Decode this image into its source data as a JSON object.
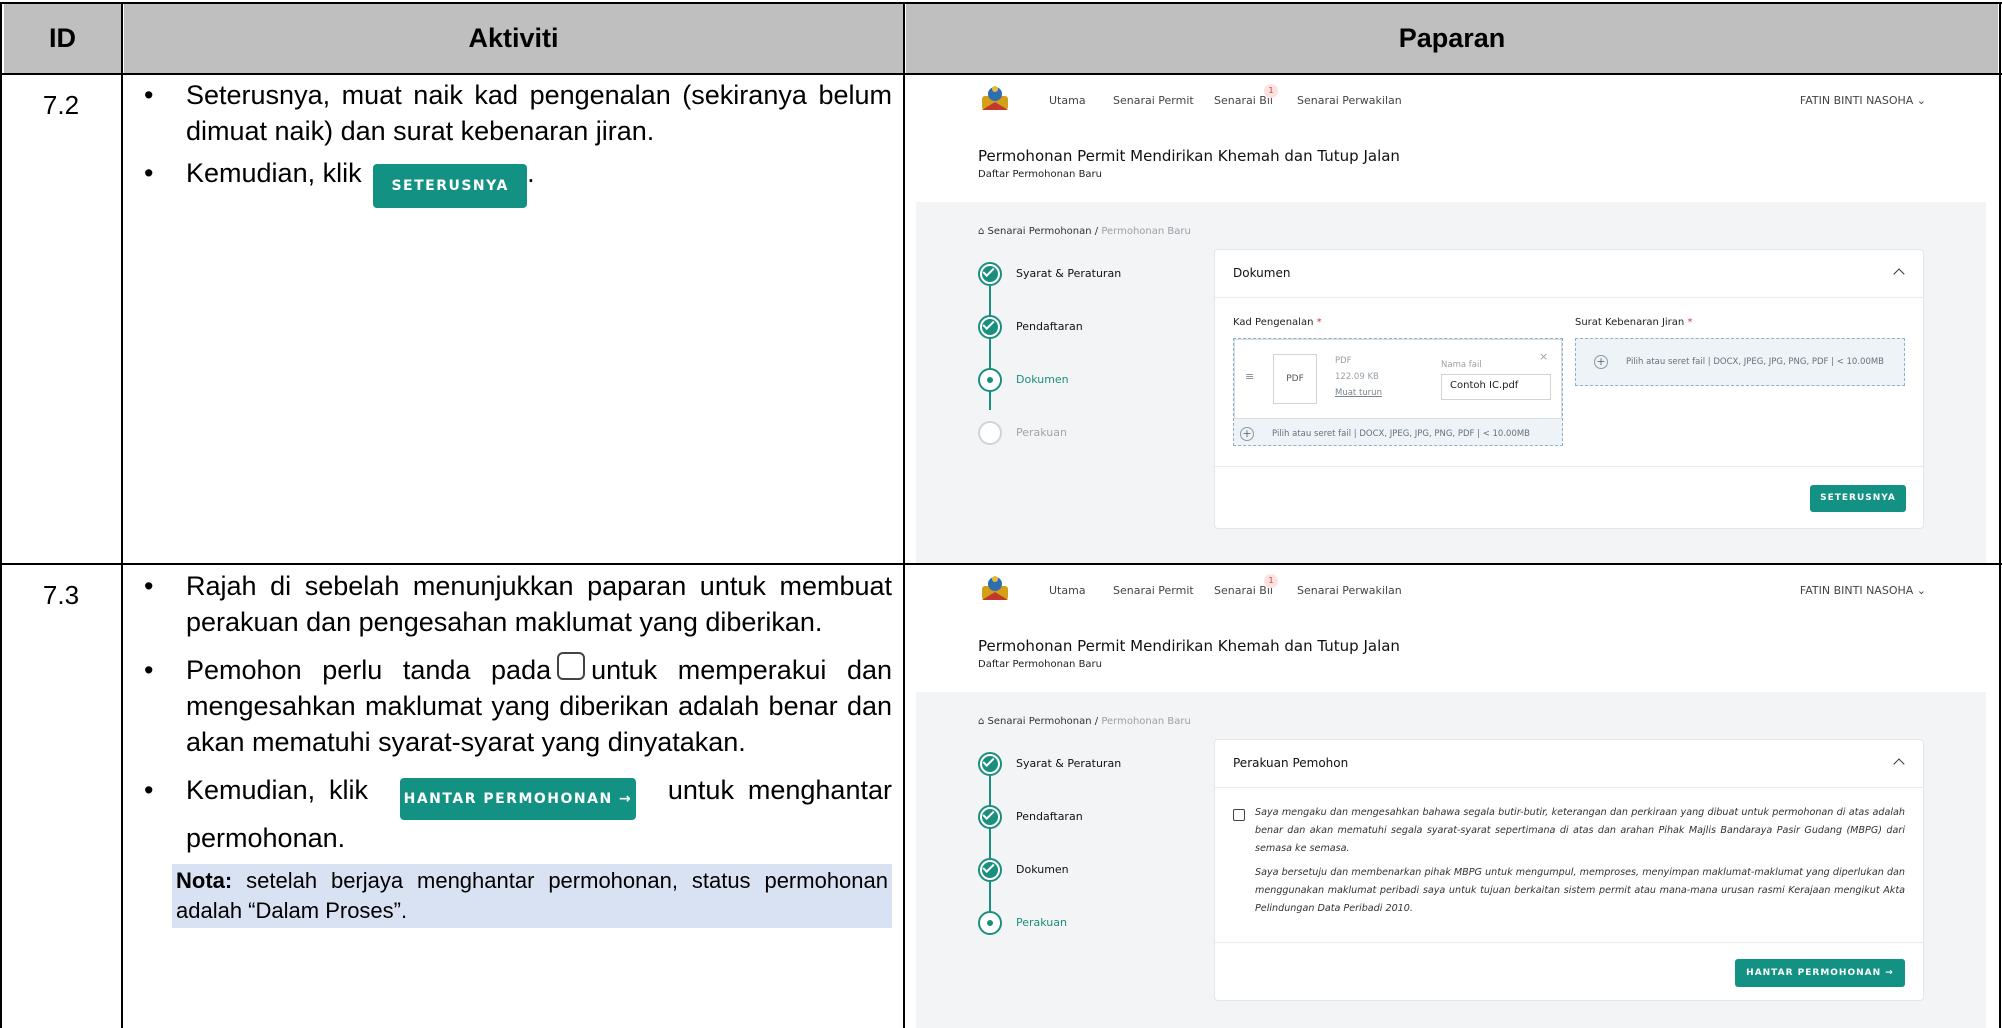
{
  "table": {
    "headers": {
      "id": "ID",
      "activity": "Aktiviti",
      "display": "Paparan"
    },
    "rows": [
      {
        "id": "7.2",
        "bullets": [
          "Seterusnya, muat naik kad pengenalan (sekiranya belum dimuat naik) dan surat kebenaran jiran.",
          "Kemudian, klik"
        ],
        "inline_button": "SETERUSNYA",
        "trailing": "."
      },
      {
        "id": "7.3",
        "bullet1": "Rajah di sebelah menunjukkan paparan untuk membuat perakuan dan pengesahan maklumat yang diberikan.",
        "bullet2_pre": "Pemohon perlu tanda pada",
        "bullet2_post": "untuk memperakui dan mengesahkan maklumat yang diberikan adalah benar dan akan mematuhi syarat-syarat yang dinyatakan.",
        "bullet3_pre": "Kemudian, klik",
        "bullet3_button": "HANTAR PERMOHONAN →",
        "bullet3_post": "untuk menghantar permohonan.",
        "note_label": "Nota:",
        "note_text": "setelah berjaya menghantar permohonan, status permohonan adalah “Dalam Proses”."
      }
    ]
  },
  "app": {
    "nav": [
      "Utama",
      "Senarai Permit",
      "Senarai Bil",
      "Senarai Perwakilan"
    ],
    "bill_badge": "1",
    "user": "FATIN BINTI NASOHA",
    "title": "Permohonan Permit Mendirikan Khemah dan Tutup Jalan",
    "subtitle": "Daftar Permohonan Baru",
    "breadcrumb": {
      "parent": "Senarai Permohonan",
      "separator": "/",
      "current": "Permohonan Baru"
    },
    "steps": [
      "Syarat & Peraturan",
      "Pendaftaran",
      "Dokumen",
      "Perakuan"
    ]
  },
  "screen1": {
    "card_title": "Dokumen",
    "ic_label": "Kad Pengenalan",
    "neighbour_label": "Surat Kebenaran Jiran",
    "required_mark": "*",
    "file": {
      "thumb": "PDF",
      "type": "PDF",
      "size": "122.09 KB",
      "download": "Muat turun",
      "name_label": "Nama fail",
      "name_value": "Contoh IC.pdf"
    },
    "upload_hint": "Pilih atau seret fail | DOCX, JPEG, JPG, PNG, PDF | < 10.00MB",
    "next_button": "SETERUSNYA"
  },
  "screen2": {
    "card_title": "Perakuan Pemohon",
    "decl1": "Saya mengaku dan mengesahkan bahawa segala butir-butir, keterangan dan perkiraan yang dibuat untuk permohonan di atas adalah benar dan akan mematuhi segala syarat-syarat sepertimana di atas dan arahan Pihak Majlis Bandaraya Pasir Gudang (MBPG) dari semasa ke semasa.",
    "decl2": "Saya bersetuju dan membenarkan pihak MBPG untuk mengumpul, memproses, menyimpan maklumat-maklumat yang diperlukan dan menggunakan maklumat peribadi saya untuk tujuan berkaitan sistem permit atau mana-mana urusan rasmi Kerajaan mengikut Akta Pelindungan Data Peribadi 2010.",
    "submit_button": "HANTAR PERMOHONAN →"
  },
  "colors": {
    "accent": "#139183",
    "header_bg": "#bfbfbf",
    "note_bg": "#d9e2f3"
  }
}
